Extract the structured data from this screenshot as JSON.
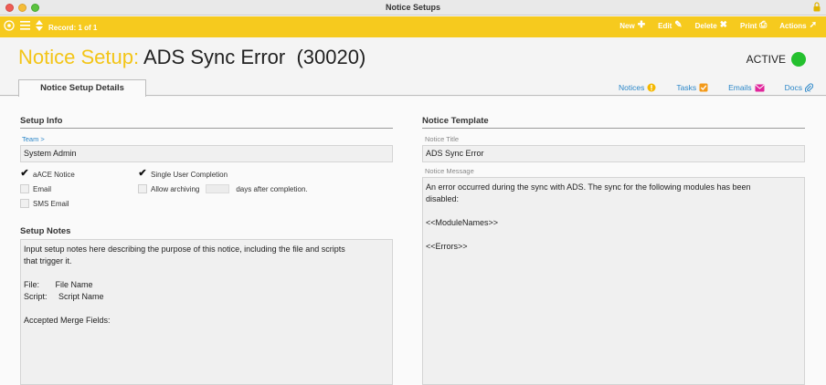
{
  "window": {
    "title": "Notice Setups"
  },
  "toolbar": {
    "record_label": "Record: 1 of 1",
    "actions": [
      {
        "label": "New",
        "glyph": "✚"
      },
      {
        "label": "Edit",
        "glyph": "✎"
      },
      {
        "label": "Delete",
        "glyph": "✖"
      },
      {
        "label": "Print",
        "glyph": "⎙"
      },
      {
        "label": "Actions",
        "glyph": "➚"
      }
    ]
  },
  "header": {
    "title_prefix": "Notice Setup:",
    "title_name": "ADS Sync Error  (30020)",
    "status": "ACTIVE",
    "status_color": "#24c02e"
  },
  "tabs": {
    "active": "Notice Setup Details"
  },
  "links": [
    {
      "label": "Notices",
      "icon_color": "#f5b800"
    },
    {
      "label": "Tasks",
      "icon_color": "#f39a1a"
    },
    {
      "label": "Emails",
      "icon_color": "#e0269b"
    },
    {
      "label": "Docs",
      "icon_color": "#2a86c8"
    }
  ],
  "setup_info": {
    "heading": "Setup Info",
    "team_label": "Team >",
    "team_value": "System Admin",
    "checkboxes": {
      "ace_notice": {
        "label": "aACE Notice",
        "checked": true
      },
      "email": {
        "label": "Email",
        "checked": false
      },
      "sms_email": {
        "label": "SMS Email",
        "checked": false
      },
      "single_user": {
        "label": "Single User Completion",
        "checked": true
      },
      "allow_archiving": {
        "label": "Allow archiving",
        "checked": false,
        "suffix": "days after completion."
      }
    }
  },
  "setup_notes": {
    "heading": "Setup Notes",
    "text": "Input setup notes here describing the purpose of this notice, including the file and scripts\nthat trigger it.\n\nFile:       File Name\nScript:     Script Name\n\nAccepted Merge Fields:"
  },
  "notice_template": {
    "heading": "Notice Template",
    "title_label": "Notice Title",
    "title_value": "ADS Sync Error",
    "message_label": "Notice Message",
    "message_text": "An error occurred during the sync with ADS. The sync for the following modules has been\ndisabled:\n\n<<ModuleNames>>\n\n<<Errors>>"
  }
}
